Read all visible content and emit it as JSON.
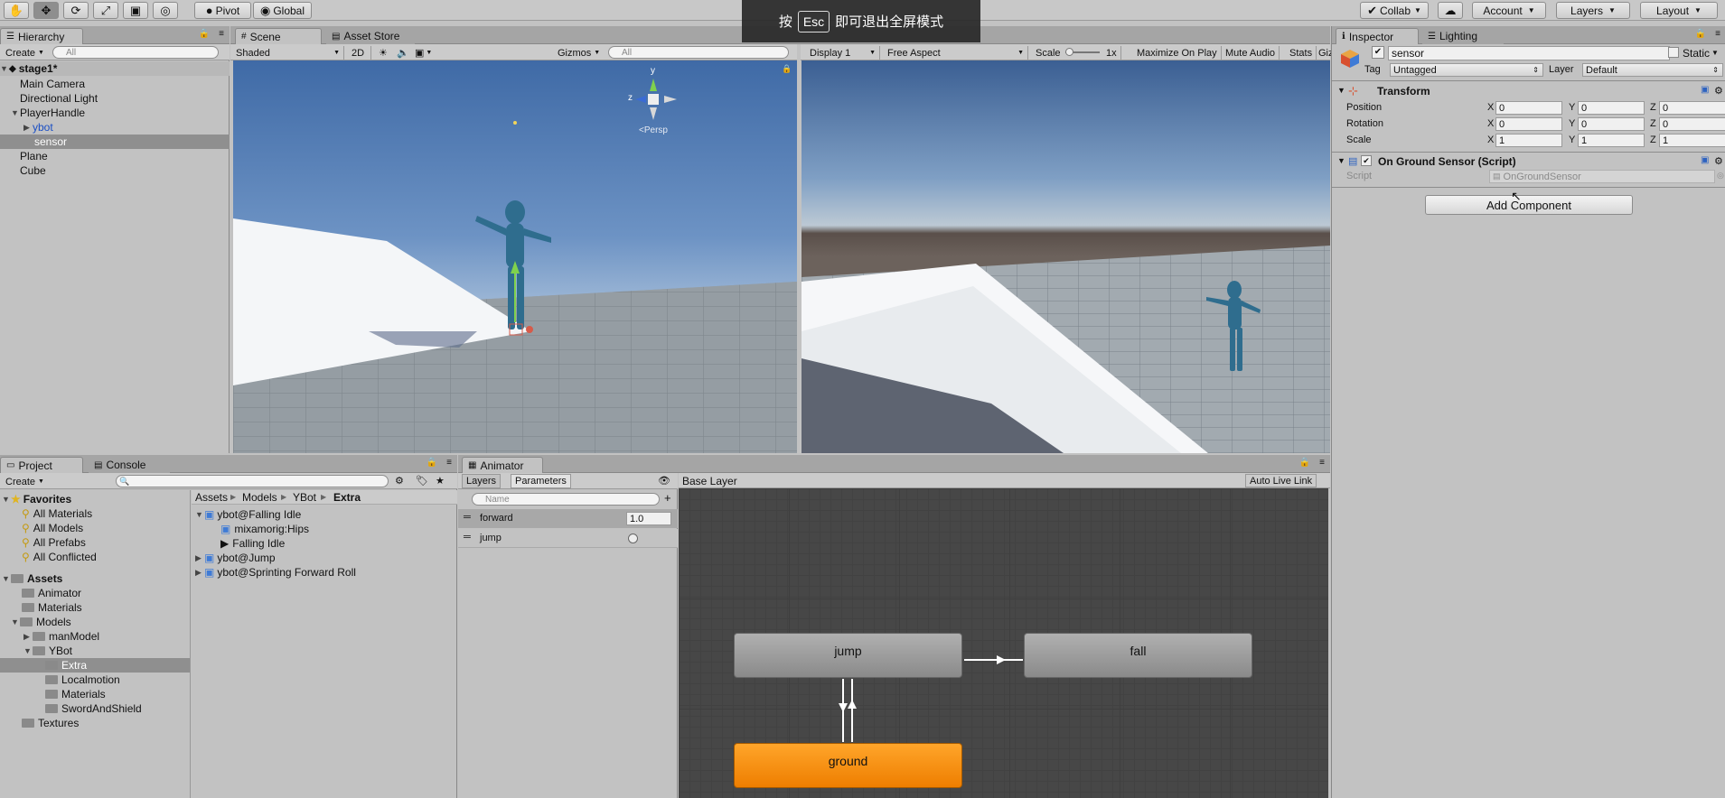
{
  "toolbar": {
    "pivot": "Pivot",
    "global": "Global",
    "collab": "Collab",
    "account": "Account",
    "layers": "Layers",
    "layout": "Layout"
  },
  "fullscreen_notice": {
    "pre": "按",
    "key": "Esc",
    "post": "即可退出全屏模式"
  },
  "hierarchy": {
    "tab": "Hierarchy",
    "create": "Create",
    "search_placeholder": "All",
    "scene": "stage1*",
    "items": [
      "Main Camera",
      "Directional Light",
      "PlayerHandle",
      "ybot",
      "sensor",
      "Plane",
      "Cube"
    ]
  },
  "scene_view": {
    "tab_scene": "Scene",
    "tab_asset_store": "Asset Store",
    "shading": "Shaded",
    "mode_2d": "2D",
    "gizmos": "Gizmos",
    "search_placeholder": "All",
    "persp": "Persp",
    "axis_y": "y",
    "axis_z": "z"
  },
  "game_view": {
    "display": "Display 1",
    "aspect": "Free Aspect",
    "scale_label": "Scale",
    "scale_value": "1x",
    "maximize": "Maximize On Play",
    "mute": "Mute Audio",
    "stats": "Stats",
    "gizmos": "Giz"
  },
  "inspector": {
    "tab": "Inspector",
    "tab_lighting": "Lighting",
    "object_name": "sensor",
    "static_label": "Static",
    "tag_label": "Tag",
    "tag_value": "Untagged",
    "layer_label": "Layer",
    "layer_value": "Default",
    "transform": {
      "title": "Transform",
      "rows": [
        {
          "label": "Position",
          "x": "0",
          "y": "0",
          "z": "0"
        },
        {
          "label": "Rotation",
          "x": "0",
          "y": "0",
          "z": "0"
        },
        {
          "label": "Scale",
          "x": "1",
          "y": "1",
          "z": "1"
        }
      ]
    },
    "component": {
      "title": "On Ground Sensor (Script)",
      "script_label": "Script",
      "script_value": "OnGroundSensor"
    },
    "add_component": "Add Component"
  },
  "project": {
    "tab": "Project",
    "tab_console": "Console",
    "create": "Create",
    "favorites_title": "Favorites",
    "favorites": [
      "All Materials",
      "All Models",
      "All Prefabs",
      "All Conflicted"
    ],
    "assets_title": "Assets",
    "tree": [
      "Animator",
      "Materials",
      "Models",
      "manModel",
      "YBot",
      "Extra",
      "Localmotion",
      "Materials",
      "SwordAndShield",
      "Textures"
    ],
    "breadcrumb": [
      "Assets",
      "Models",
      "YBot",
      "Extra"
    ],
    "files": [
      "ybot@Falling Idle",
      "mixamorig:Hips",
      "Falling Idle",
      "ybot@Jump",
      "ybot@Sprinting Forward Roll"
    ]
  },
  "animator": {
    "tab": "Animator",
    "tab_layers": "Layers",
    "tab_parameters": "Parameters",
    "search_placeholder": "Name",
    "params": [
      {
        "name": "forward",
        "value": "1.0"
      },
      {
        "name": "jump",
        "value": ""
      }
    ],
    "layer": "Base Layer",
    "auto_live_link": "Auto Live Link",
    "states": {
      "jump": "jump",
      "fall": "fall",
      "ground": "ground"
    }
  },
  "colors": {
    "state_default": "#8e8e8e",
    "state_entry": "#f28a0d",
    "selection": "#8f8f8f",
    "sky": "#4e7cb8"
  }
}
